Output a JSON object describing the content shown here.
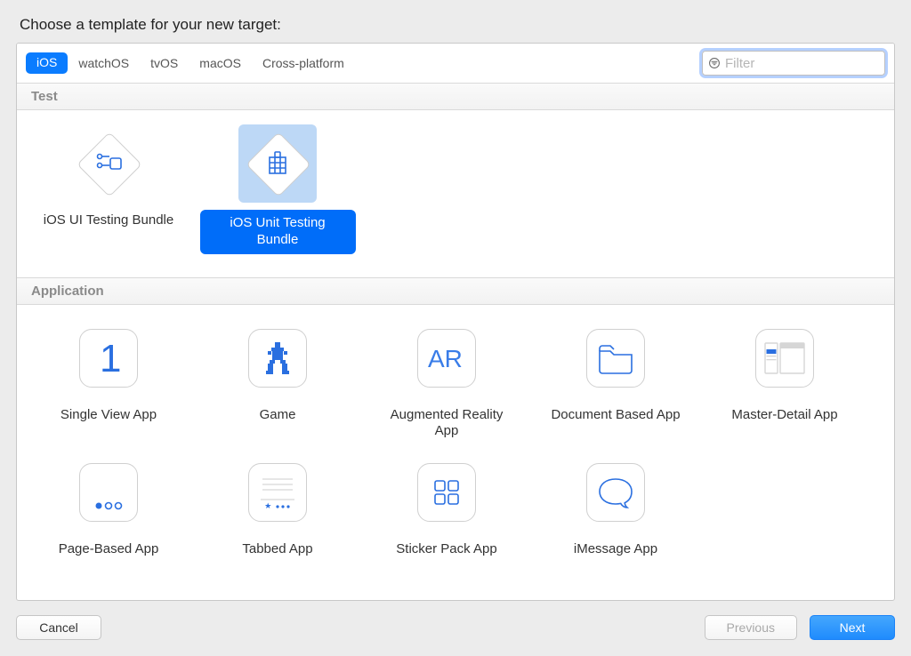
{
  "header": {
    "title": "Choose a template for your new target:"
  },
  "tabs": {
    "items": [
      "iOS",
      "watchOS",
      "tvOS",
      "macOS",
      "Cross-platform"
    ],
    "active": "iOS"
  },
  "filter": {
    "placeholder": "Filter",
    "value": ""
  },
  "sections": {
    "test": {
      "title": "Test",
      "items": [
        {
          "label": "iOS UI Testing Bundle"
        },
        {
          "label": "iOS Unit Testing Bundle"
        }
      ],
      "selected": "iOS Unit Testing Bundle"
    },
    "application": {
      "title": "Application",
      "items": [
        {
          "label": "Single View App"
        },
        {
          "label": "Game"
        },
        {
          "label": "Augmented Reality App"
        },
        {
          "label": "Document Based App"
        },
        {
          "label": "Master-Detail App"
        },
        {
          "label": "Page-Based App"
        },
        {
          "label": "Tabbed App"
        },
        {
          "label": "Sticker Pack App"
        },
        {
          "label": "iMessage App"
        }
      ]
    }
  },
  "footer": {
    "cancel": "Cancel",
    "previous": "Previous",
    "next": "Next"
  }
}
